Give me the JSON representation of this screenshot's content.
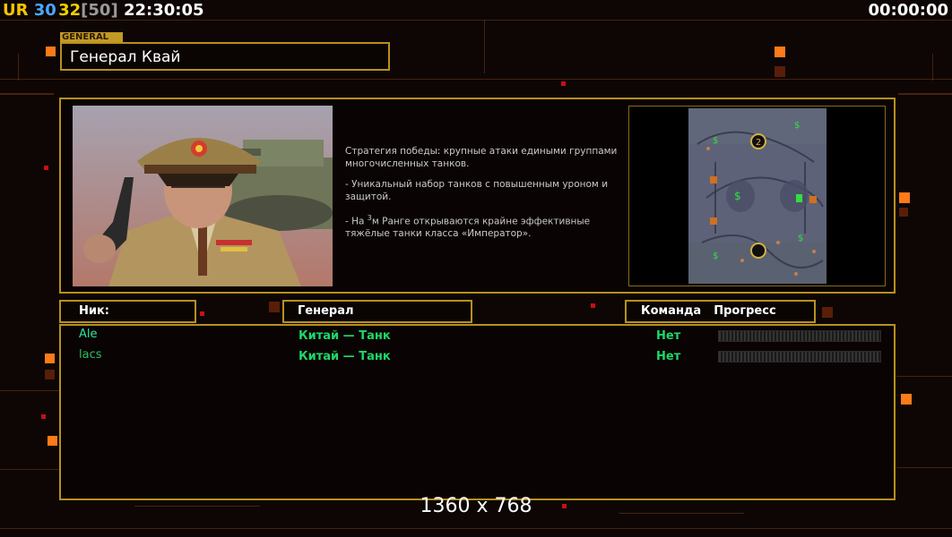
{
  "hud": {
    "ur": "UR",
    "n1": "30",
    "n2": "32",
    "bracket": "[50]",
    "clock": "22:30:05",
    "timer": "00:00:00"
  },
  "general_section": {
    "tag": "GENERAL",
    "name": "Генерал Квай"
  },
  "description": {
    "strategy": "Стратегия победы: крупные атаки едиными группами многочисленных танков.",
    "bullet1": "- Уникальный набор танков с повышенным уроном и защитой.",
    "bullet2_prefix": "- На ",
    "bullet2_sup": "3",
    "bullet2_suffix": "м Ранге открываются крайне эффективные тяжёлые танки класса «Император»."
  },
  "table": {
    "headers": {
      "nick": "Ник:",
      "general": "Генерал",
      "team": "Команда",
      "progress": "Прогресс"
    },
    "rows": [
      {
        "nick": "Ale",
        "general": "Китай — Танк",
        "team": "Нет",
        "nick_color": "#2ee6a0"
      },
      {
        "nick": "lacs",
        "general": "Китай — Танк",
        "team": "Нет",
        "nick_color": "#28c060"
      }
    ]
  },
  "resolution_label": "1360 x 768",
  "colors": {
    "gold": "#b8901e",
    "green": "#1ed86a",
    "hud_ur": "#f5c400",
    "hud_n1": "#4aa8ff",
    "hud_n2": "#f0d000",
    "hud_bracket": "#9a9a9a",
    "accent_orange": "#ff7a18"
  },
  "minimap": {
    "supply_icons": [
      "dollar-icon",
      "dollar-icon",
      "dollar-icon",
      "dollar-icon",
      "dollar-icon"
    ],
    "start_markers": [
      "2",
      ""
    ]
  }
}
